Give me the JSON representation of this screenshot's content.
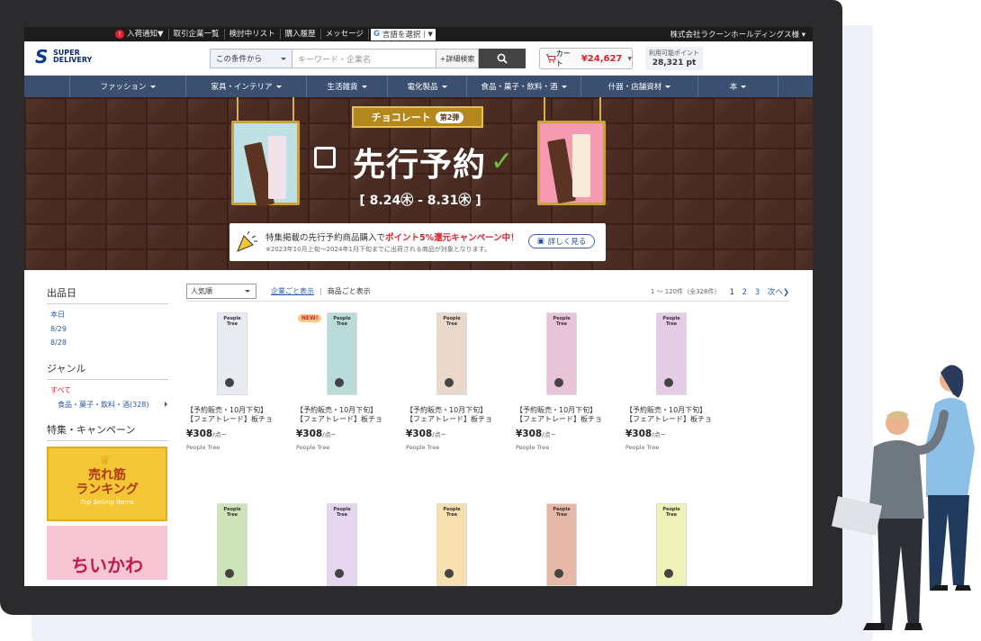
{
  "util": {
    "badge": "!",
    "items": [
      "入荷通知▼",
      "取引企業一覧",
      "検討中リスト",
      "購入履歴",
      "メッセージ"
    ],
    "translate": "言語を選択",
    "account": "株式会社ラクーンホールディングス様 ▾"
  },
  "header": {
    "logo_line1": "SUPER",
    "logo_line2": "DELIVERY",
    "search_scope": "この条件から",
    "search_placeholder": "キーワード・企業名",
    "advanced": "+詳細検索",
    "cart_label": "カート",
    "cart_amount": "¥24,627",
    "points_label": "利用可能ポイント",
    "points_value": "28,321 pt"
  },
  "nav": [
    "ファッション",
    "家具・インテリア",
    "生活雑貨",
    "電化製品",
    "食品・菓子・飲料・酒",
    "什器・店舗資材",
    "本"
  ],
  "banner": {
    "ribbon": "チョコレート",
    "episode": "第2弾",
    "headline": "先行予約",
    "dates": "[ 8.24㊍ - 8.31㊍ ]",
    "promo_main_prefix": "特集掲載の先行予約商品購入で",
    "promo_main_highlight": "ポイント5%還元キャンペーン中！",
    "promo_sub": "※2023年10月上旬〜2024年1月下旬までに出荷される商品が対象となります。",
    "promo_button": "詳しく見る"
  },
  "sidebar": {
    "date_title": "出品日",
    "dates": [
      "本日",
      "8/29",
      "8/28"
    ],
    "genre_title": "ジャンル",
    "genre_all": "すべて",
    "genre_item": "食品・菓子・飲料・酒(328)",
    "campaign_title": "特集・キャンペーン",
    "rank_line1": "売れ筋",
    "rank_line2": "ランキング",
    "rank_en": "Top Selling Items",
    "chii": "ちいかわ"
  },
  "list": {
    "sort": "人気順",
    "view_company": "企業ごと表示",
    "view_product": "商品ごと表示",
    "count": "1 〜 120件（全328件）",
    "pages": [
      "1",
      "2",
      "3"
    ],
    "next": "次へ"
  },
  "products": [
    {
      "title1": "【予約販売・10月下旬】",
      "title2": "【フェアトレード】板チョ",
      "price": "¥308",
      "unit": "/点~",
      "brand": "People Tree",
      "tag": "People Tree",
      "new": "",
      "color": "#e8ecf2"
    },
    {
      "title1": "【予約販売・10月下旬】",
      "title2": "【フェアトレード】板チョ",
      "price": "¥308",
      "unit": "/点~",
      "brand": "People Tree",
      "tag": "People Tree",
      "new": "NEW!",
      "color": "#b9dcd8"
    },
    {
      "title1": "【予約販売・10月下旬】",
      "title2": "【フェアトレード】板チョ",
      "price": "¥308",
      "unit": "/点~",
      "brand": "People Tree",
      "tag": "People Tree",
      "new": "",
      "color": "#e9d9cc"
    },
    {
      "title1": "【予約販売・10月下旬】",
      "title2": "【フェアトレード】板チョ",
      "price": "¥308",
      "unit": "/点~",
      "brand": "People Tree",
      "tag": "People Tree",
      "new": "",
      "color": "#e7c4d8"
    },
    {
      "title1": "【予約販売・10月下旬】",
      "title2": "【フェアトレード】板チョ",
      "price": "¥308",
      "unit": "/点~",
      "brand": "People Tree",
      "tag": "People Tree",
      "new": "",
      "color": "#e5cde6"
    },
    {
      "title1": "",
      "title2": "",
      "price": "",
      "unit": "",
      "brand": "",
      "tag": "People Tree",
      "new": "",
      "color": "#cfe3b8"
    },
    {
      "title1": "",
      "title2": "",
      "price": "",
      "unit": "",
      "brand": "",
      "tag": "People Tree",
      "new": "",
      "color": "#e4d6ee"
    },
    {
      "title1": "",
      "title2": "",
      "price": "",
      "unit": "",
      "brand": "",
      "tag": "People Tree",
      "new": "",
      "color": "#f6e0b0"
    },
    {
      "title1": "",
      "title2": "",
      "price": "",
      "unit": "",
      "brand": "",
      "tag": "People Tree",
      "new": "",
      "color": "#e6b8a8"
    },
    {
      "title1": "",
      "title2": "",
      "price": "",
      "unit": "",
      "brand": "",
      "tag": "People Tree",
      "new": "",
      "color": "#eef2b8"
    }
  ]
}
